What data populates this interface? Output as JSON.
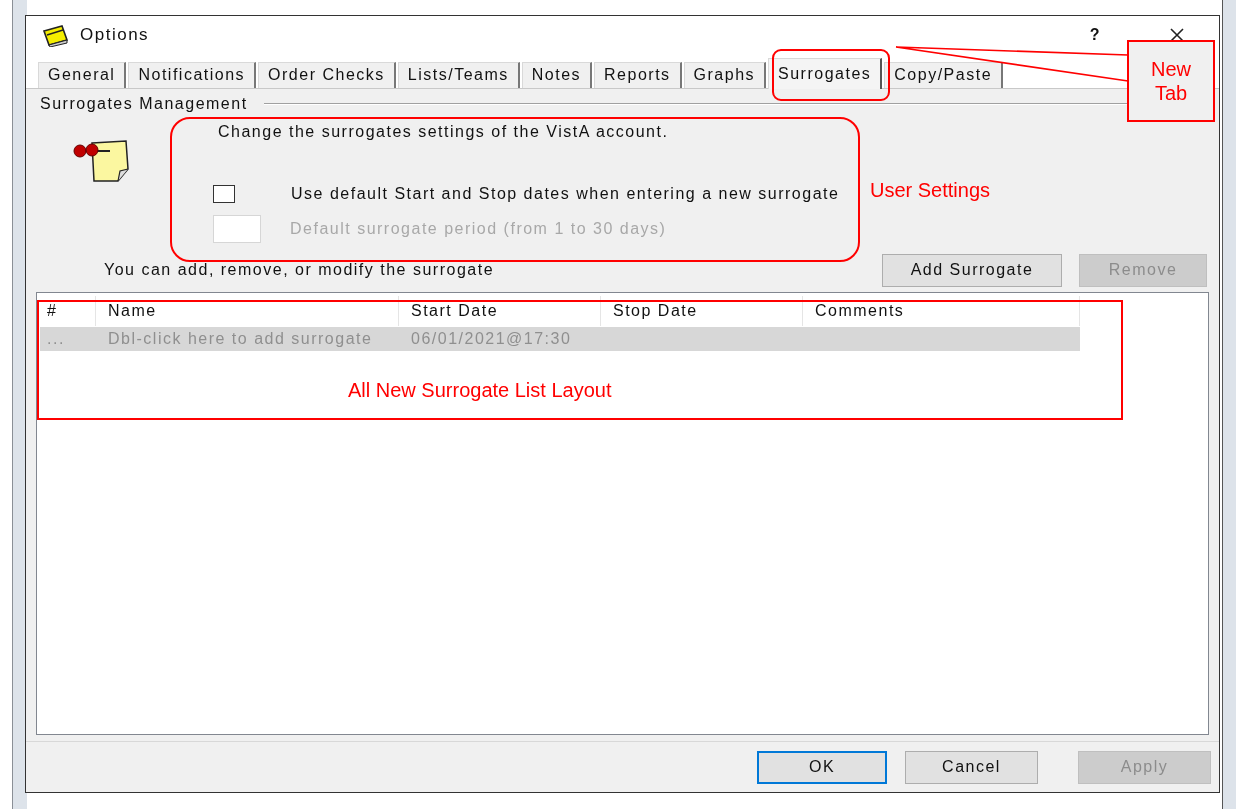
{
  "window": {
    "title": "Options",
    "help": "?"
  },
  "tabs": [
    {
      "label": "General",
      "selected": false
    },
    {
      "label": "Notifications",
      "selected": false
    },
    {
      "label": "Order Checks",
      "selected": false
    },
    {
      "label": "Lists/Teams",
      "selected": false
    },
    {
      "label": "Notes",
      "selected": false
    },
    {
      "label": "Reports",
      "selected": false
    },
    {
      "label": "Graphs",
      "selected": false
    },
    {
      "label": "Surrogates",
      "selected": true
    },
    {
      "label": "Copy/Paste",
      "selected": false
    }
  ],
  "group": {
    "title": "Surrogates Management",
    "description": "Change the surrogates settings of the VistA account.",
    "checkbox": {
      "label": "Use default Start and Stop dates when entering a new surrogate",
      "checked": false
    },
    "period_field": {
      "label": "Default surrogate period (from 1 to 30 days)",
      "disabled": true
    }
  },
  "list_caption": "You can add, remove, or modify the surrogate",
  "list_buttons": [
    {
      "label": "Add Surrogate",
      "disabled": false
    },
    {
      "label": "Remove",
      "disabled": true
    }
  ],
  "table": {
    "columns": [
      "#",
      "Name",
      "Start Date",
      "Stop Date",
      "Comments"
    ],
    "rows": [
      {
        "kind": "placeholder",
        "cells": [
          "...",
          "Dbl-click here to add surrogate",
          "06/01/2021@17:30",
          "",
          ""
        ]
      }
    ]
  },
  "footer_buttons": [
    {
      "label": "OK",
      "default": true,
      "disabled": false
    },
    {
      "label": "Cancel",
      "default": false,
      "disabled": false
    },
    {
      "label": "Apply",
      "default": false,
      "disabled": true
    }
  ],
  "annotations": [
    {
      "kind": "callout",
      "text": "New Tab"
    },
    {
      "kind": "label",
      "text": "User Settings"
    },
    {
      "kind": "box-label",
      "text": "All New Surrogate List Layout"
    }
  ]
}
